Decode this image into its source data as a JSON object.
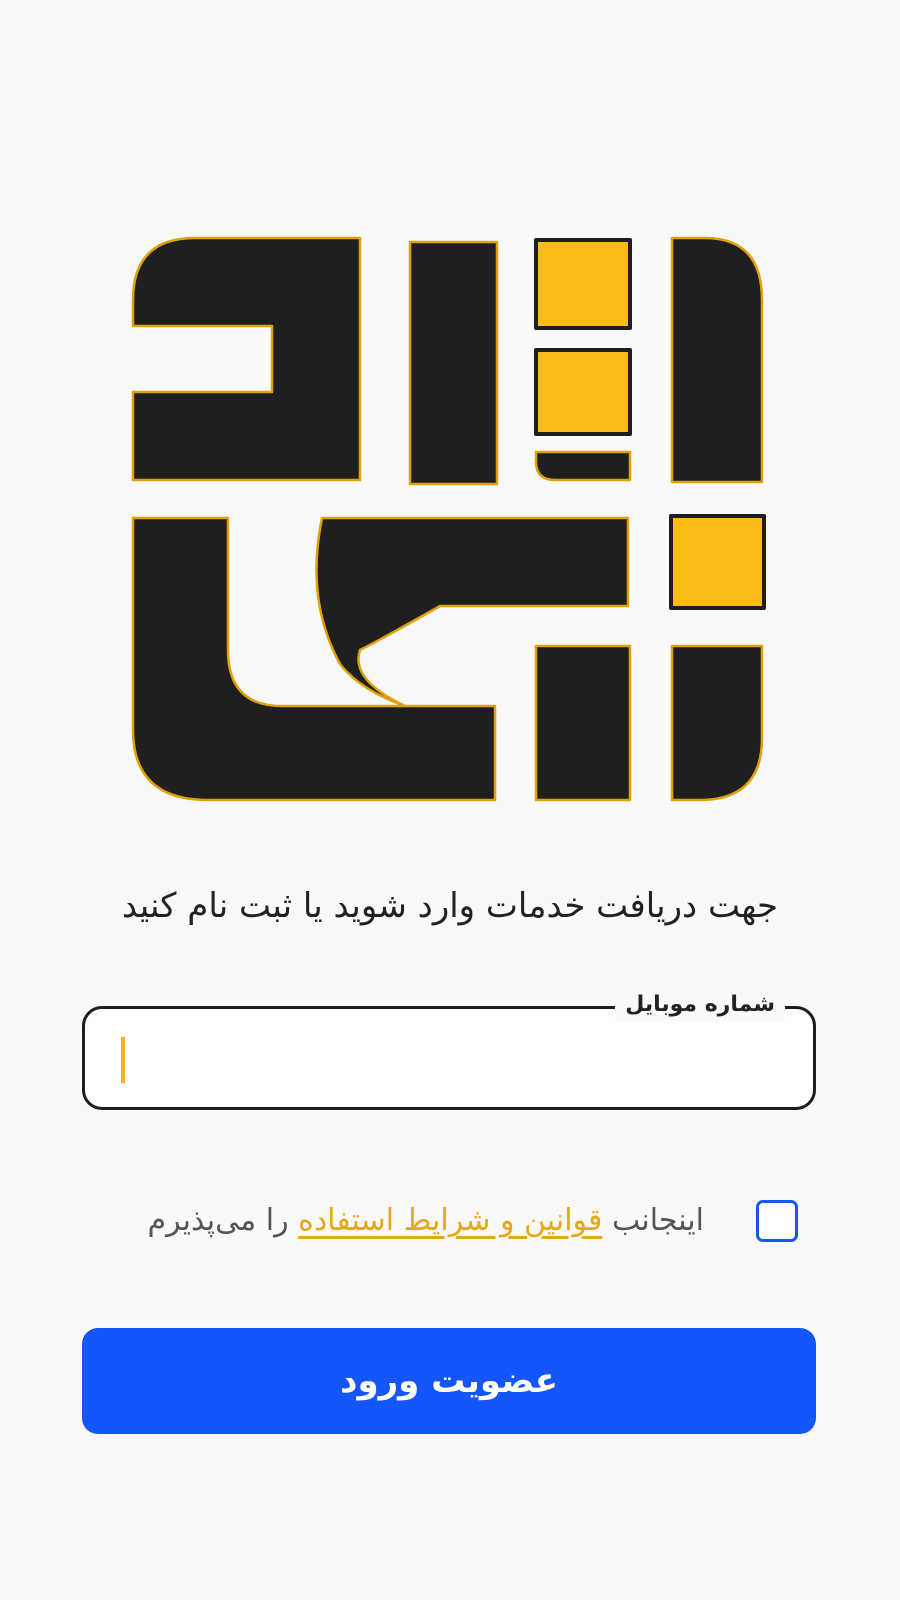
{
  "logo": {
    "name": "app-logo",
    "colors": {
      "dark": "#1f1f1f",
      "accent": "#fbbc17",
      "outline": "#e0a20a"
    }
  },
  "subtitle": "جهت دریافت خدمات وارد شوید یا ثبت نام کنید",
  "mobile_field": {
    "label": "شماره موبایل",
    "value": "",
    "placeholder": ""
  },
  "terms": {
    "checked": false,
    "prefix": "اینجانب",
    "link_text": "قوانین و شرایط استفاده",
    "suffix": "را می‌پذیرم"
  },
  "submit_button": {
    "label": "عضویت ورود"
  },
  "colors": {
    "background": "#f9f9fa",
    "primary": "#1456fb",
    "accent": "#f4b614",
    "checkbox_border": "#1756f0"
  }
}
